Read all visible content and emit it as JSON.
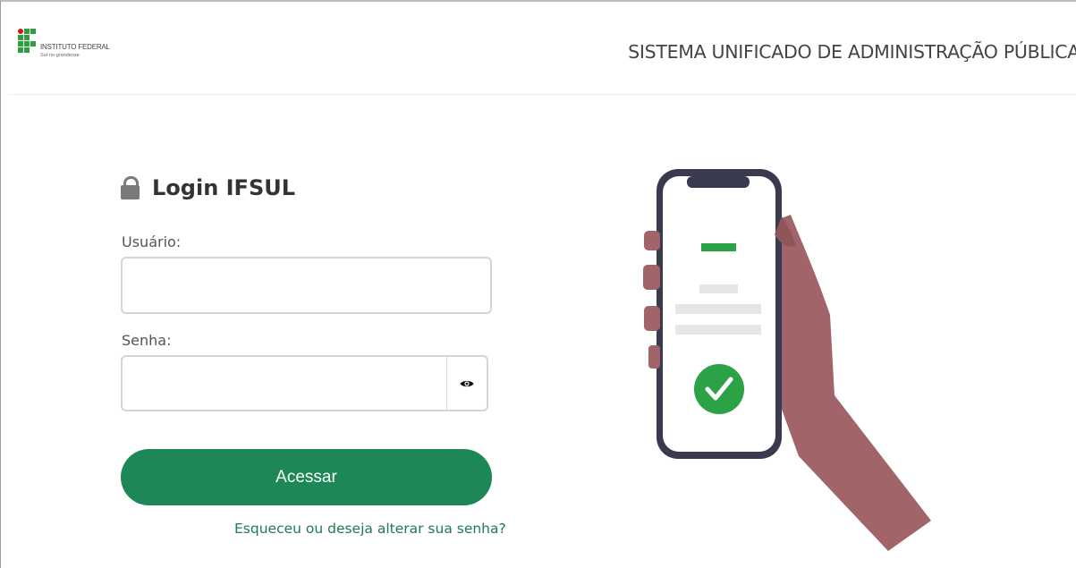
{
  "header": {
    "logo_line1": "INSTITUTO FEDERAL",
    "logo_line2": "Sul-rio-grandense",
    "system_title": "SISTEMA UNIFICADO DE ADMINISTRAÇÃO PÚBLICA"
  },
  "login": {
    "title": "Login IFSUL",
    "username_label": "Usuário:",
    "username_value": "",
    "password_label": "Senha:",
    "password_value": "",
    "submit_label": "Acessar",
    "forgot_link": "Esqueceu ou deseja alterar sua senha?"
  },
  "icons": {
    "lock": "lock-icon",
    "eye": "eye-icon",
    "check": "check-circle-icon"
  },
  "colors": {
    "primary_green": "#1d8755",
    "link_green": "#1f7a4d",
    "logo_red": "#c8191e",
    "logo_green": "#2e9e3f",
    "hand": "#a06469"
  }
}
